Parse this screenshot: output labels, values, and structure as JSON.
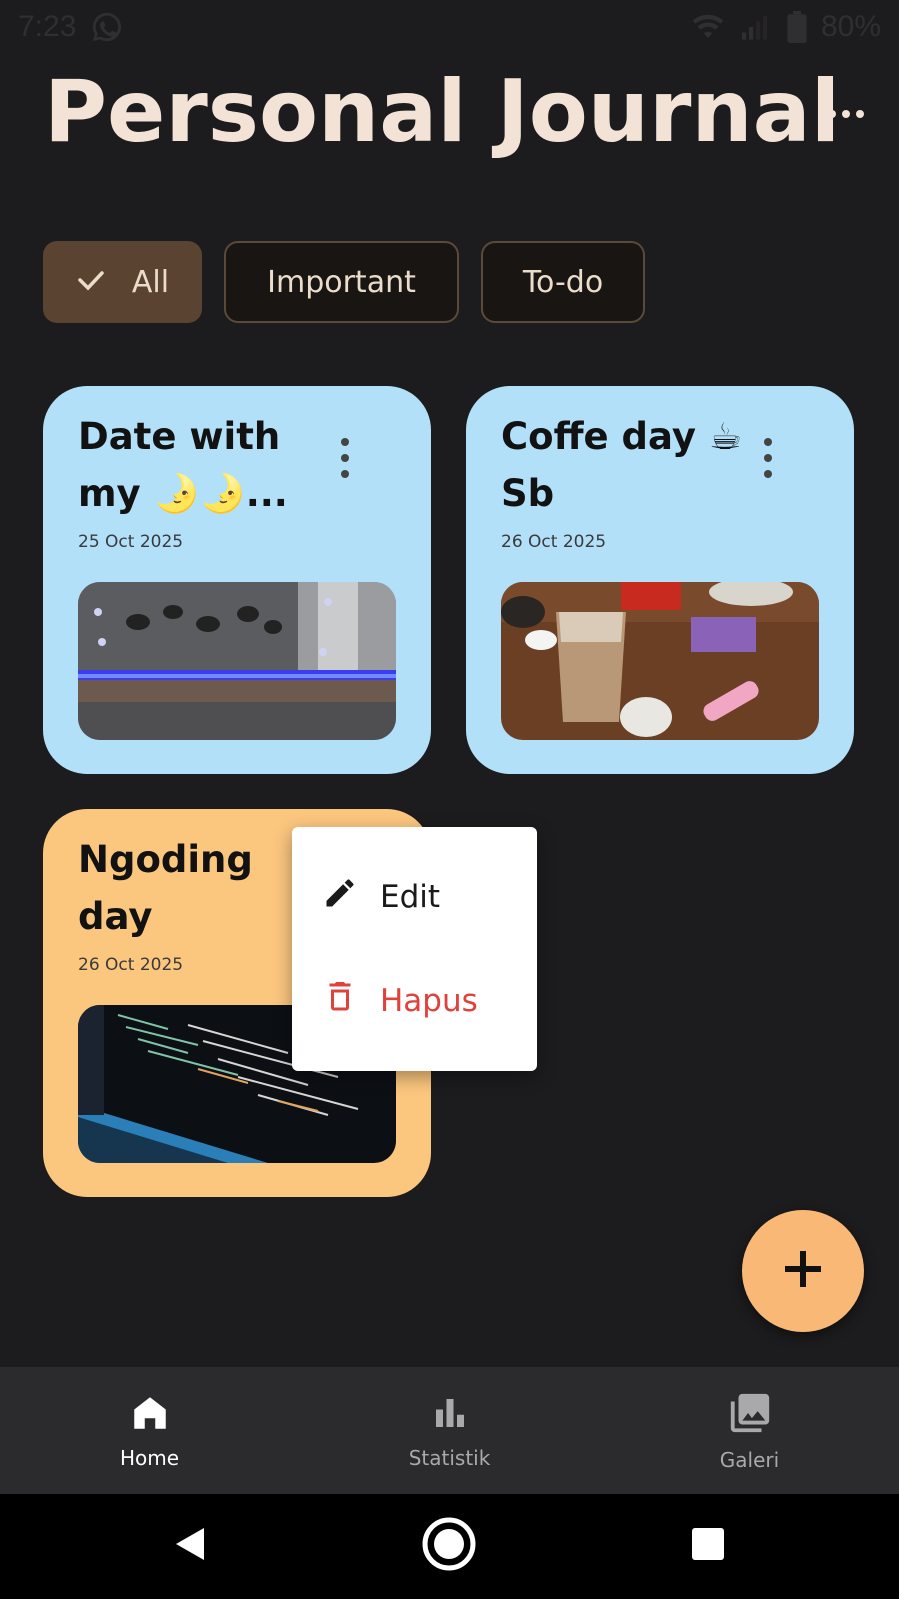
{
  "status_bar": {
    "time": "7:23",
    "battery": "80%"
  },
  "header": {
    "title": "Personal Journal"
  },
  "filters": [
    {
      "label": "All",
      "selected": true
    },
    {
      "label": "Important",
      "selected": false
    },
    {
      "label": "To-do",
      "selected": false
    }
  ],
  "cards": [
    {
      "title": "Date with my 🌛🌛...",
      "date": "25 Oct 2025",
      "color": "#b2e0f9"
    },
    {
      "title": "Coffe day ☕ Sb",
      "date": "26 Oct 2025",
      "color": "#b2e0f9"
    },
    {
      "title": "Ngoding day",
      "date": "26 Oct 2025",
      "color": "#fbc67e"
    }
  ],
  "popup_menu": {
    "edit_label": "Edit",
    "delete_label": "Hapus"
  },
  "bottom_nav": [
    {
      "label": "Home",
      "icon": "home-icon",
      "active": true
    },
    {
      "label": "Statistik",
      "icon": "bar-chart-icon",
      "active": false
    },
    {
      "label": "Galeri",
      "icon": "photo-library-icon",
      "active": false
    }
  ],
  "colors": {
    "background": "#1c1b1d",
    "accent": "#f9b875",
    "danger": "#e0413b"
  }
}
